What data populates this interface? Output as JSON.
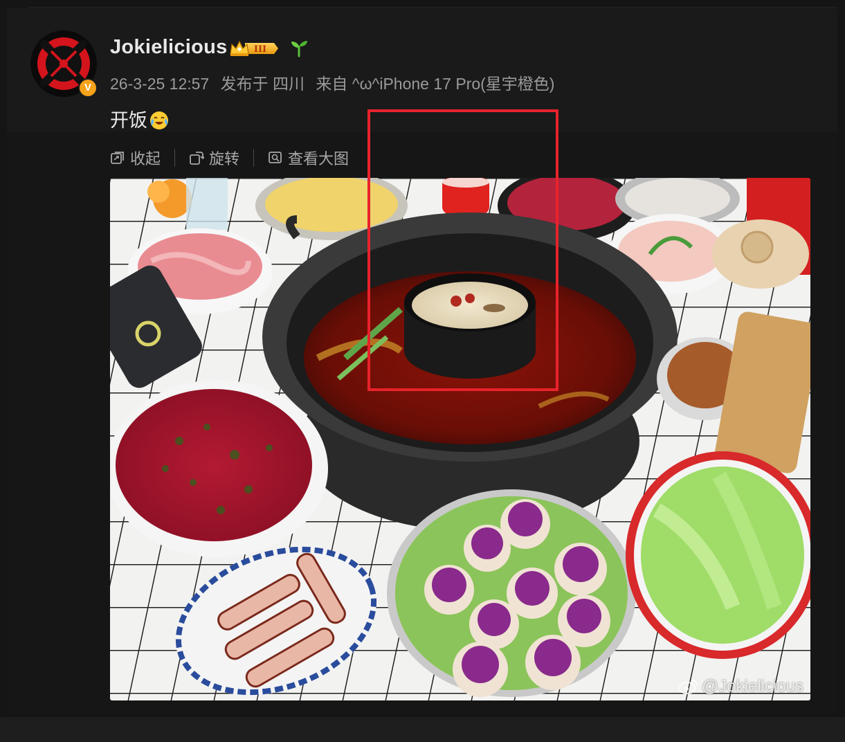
{
  "post": {
    "username": "Jokielicious",
    "level_badge": "III",
    "verified_mark": "V",
    "timestamp": "26-3-25 12:57",
    "location": "发布于 四川",
    "source": "来自 ^ω^iPhone 17 Pro(星宇橙色)",
    "text": "开饭",
    "emoji_icon": "crying-laughing-emoji-icon"
  },
  "toolbar": {
    "collapse_label": "收起",
    "rotate_label": "旋转",
    "view_large_label": "查看大图"
  },
  "image": {
    "watermark": "@Jokielicious"
  },
  "colors": {
    "highlight": "#e8222b",
    "badge_gold": "#f7a21b",
    "background": "#151515"
  }
}
